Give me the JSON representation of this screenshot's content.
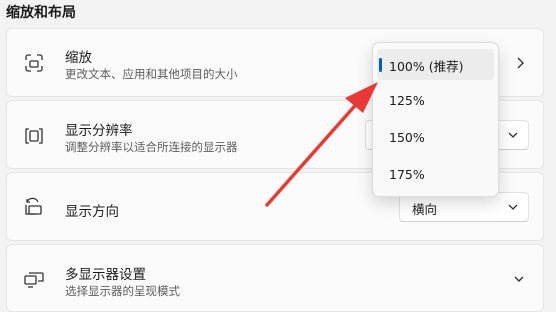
{
  "section": {
    "title": "缩放和布局"
  },
  "scale": {
    "title": "缩放",
    "description": "更改文本、应用和其他项目的大小",
    "options": [
      "100% (推荐)",
      "125%",
      "150%",
      "175%"
    ],
    "selected": "100% (推荐)",
    "icon": "scale-icon"
  },
  "resolution": {
    "title": "显示分辨率",
    "description": "调整分辨率以适合所连接的显示器",
    "icon": "resolution-icon"
  },
  "orientation": {
    "title": "显示方向",
    "value": "横向",
    "icon": "orientation-icon"
  },
  "multi_display": {
    "title": "多显示器设置",
    "description": "选择显示器的呈现模式",
    "icon": "multi-display-icon"
  },
  "colors": {
    "accent": "#005fb8",
    "arrow": "#e83a35"
  }
}
